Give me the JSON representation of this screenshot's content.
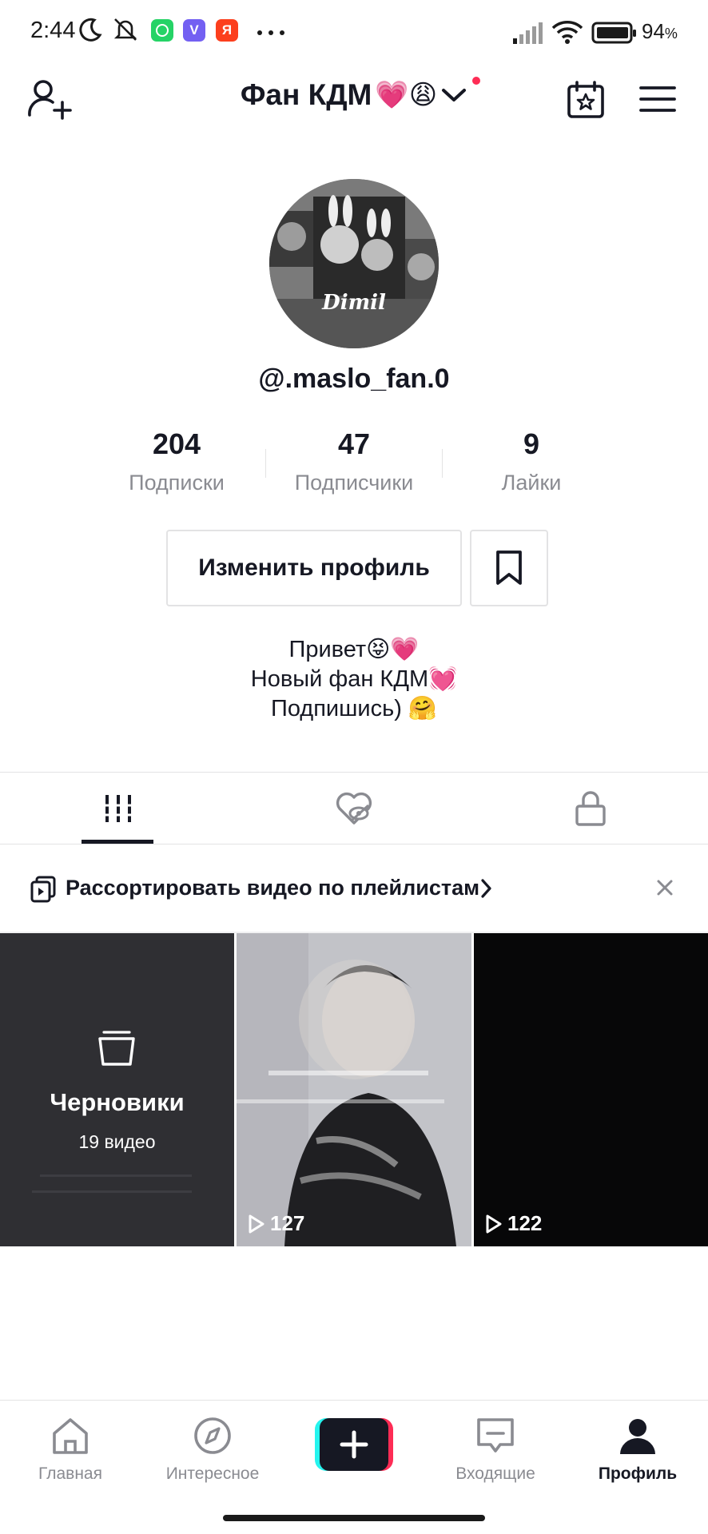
{
  "status_bar": {
    "time": "2:44",
    "battery": "94",
    "battery_unit": "%",
    "viber_letter": "V",
    "yandex_letter": "Я"
  },
  "header": {
    "title": "Фан КДМ",
    "title_emoji": "💗😩"
  },
  "profile": {
    "username": "@.maslo_fan.0",
    "avatar_caption": "Dimil",
    "stats": [
      {
        "value": "204",
        "label": "Подписки"
      },
      {
        "value": "47",
        "label": "Подписчики"
      },
      {
        "value": "9",
        "label": "Лайки"
      }
    ],
    "edit_button": "Изменить профиль",
    "bio": [
      "Привет😝💗",
      "Новый фан КДМ💓",
      "Подпишись) 🤗"
    ]
  },
  "playlist_banner": {
    "label": "Рассортировать видео по плейлистам"
  },
  "grid": {
    "drafts_title": "Черновики",
    "drafts_count": "19 видео",
    "videos": [
      {
        "views": "127"
      },
      {
        "views": "122"
      }
    ]
  },
  "nav": {
    "items": [
      {
        "label": "Главная"
      },
      {
        "label": "Интересное"
      },
      {
        "label": "Входящие"
      },
      {
        "label": "Профиль"
      }
    ]
  },
  "colors": {
    "accent": "#fe2c55",
    "create_left": "#25f4ee",
    "create_right": "#fe2c55",
    "text": "#161823",
    "muted": "#8a8b91"
  }
}
